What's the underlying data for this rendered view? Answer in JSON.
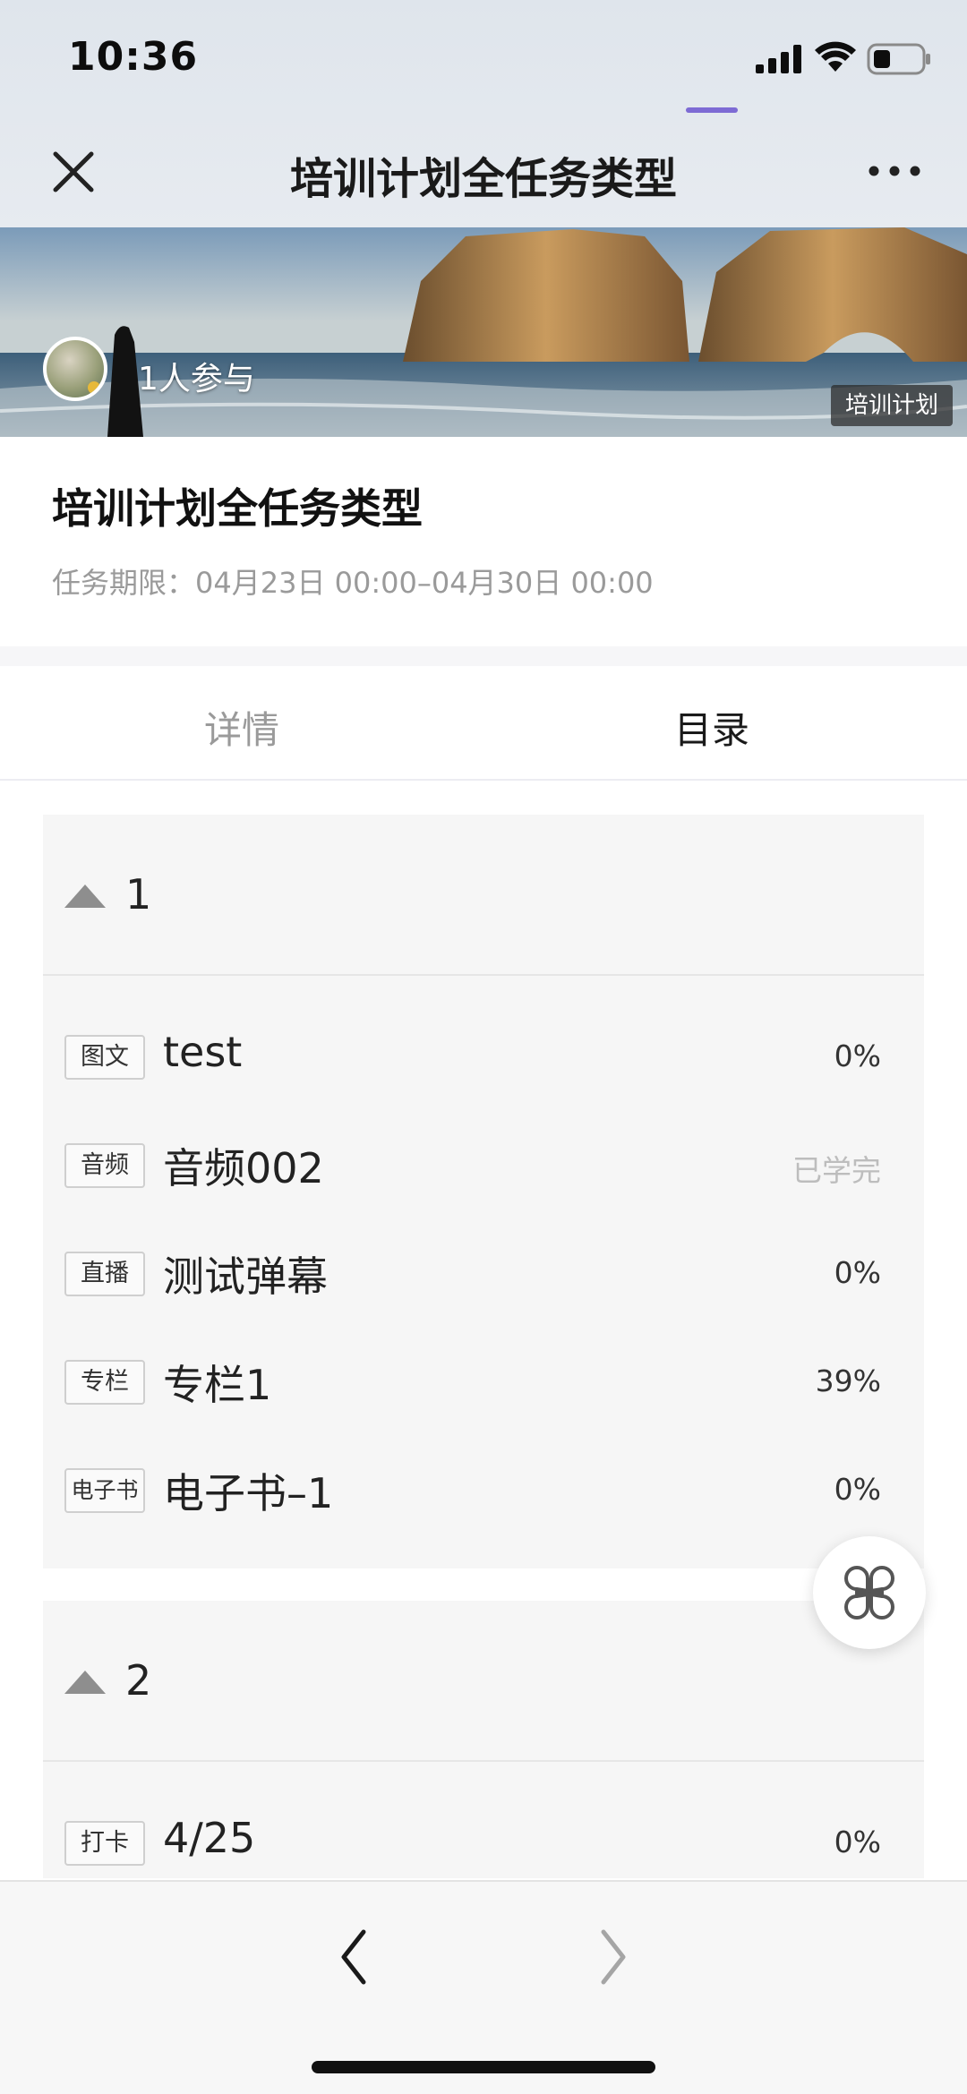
{
  "status_bar": {
    "time": "10:36"
  },
  "nav": {
    "title": "培训计划全任务类型"
  },
  "banner": {
    "participants": "1人参与",
    "type_badge": "培训计划"
  },
  "info": {
    "title": "培训计划全任务类型",
    "deadline": "任务期限：04月23日 00:00–04月30日 00:00"
  },
  "tabs": [
    {
      "label": "详情",
      "active": false
    },
    {
      "label": "目录",
      "active": true
    }
  ],
  "chapters": [
    {
      "number": "1",
      "items": [
        {
          "tag": "图文",
          "title": "test",
          "progress": "0%"
        },
        {
          "tag": "音频",
          "title": "音频002",
          "progress": "已学完"
        },
        {
          "tag": "直播",
          "title": "测试弹幕",
          "progress": "0%"
        },
        {
          "tag": "专栏",
          "title": "专栏1",
          "progress": "39%"
        },
        {
          "tag": "电子书",
          "title": "电子书–1",
          "progress": "0%"
        }
      ]
    },
    {
      "number": "2",
      "items": [
        {
          "tag": "打卡",
          "title": "4/25",
          "progress": "0%"
        }
      ]
    }
  ],
  "colors": {
    "accent": "#7d6bd4",
    "chapter_bg": "#f6f6f6",
    "muted_text": "#9a9a9a",
    "done_text": "#bdbdbd"
  },
  "icons": {
    "close": "close-icon",
    "more": "more-icon",
    "collapse": "triangle-up-icon",
    "float_menu": "clover-menu-icon",
    "back": "chevron-left-icon",
    "forward": "chevron-right-icon"
  }
}
